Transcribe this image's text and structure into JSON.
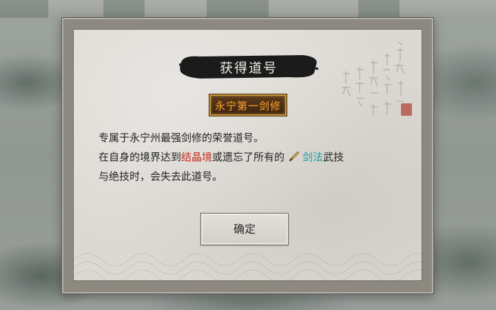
{
  "dialog": {
    "title": "获得道号",
    "honor_title": "永宁第一剑修",
    "description_line1": "专属于永宁州最强剑修的荣誉道号。",
    "description_line2_prefix": "在自身的境界达到",
    "realm_highlight": "结晶境",
    "description_line2_middle": "或遗忘了所有的",
    "skill_highlight": "剑法",
    "description_line2_suffix": "武技",
    "description_line3": "与绝技时，会失去此道号。",
    "confirm_label": "确定",
    "skill_icon": "brush-icon"
  },
  "colors": {
    "realm_highlight": "#c62f20",
    "skill_highlight": "#1a9aa0",
    "plaque_text": "#f1a43a",
    "title_banner": "#1b1b1b"
  }
}
